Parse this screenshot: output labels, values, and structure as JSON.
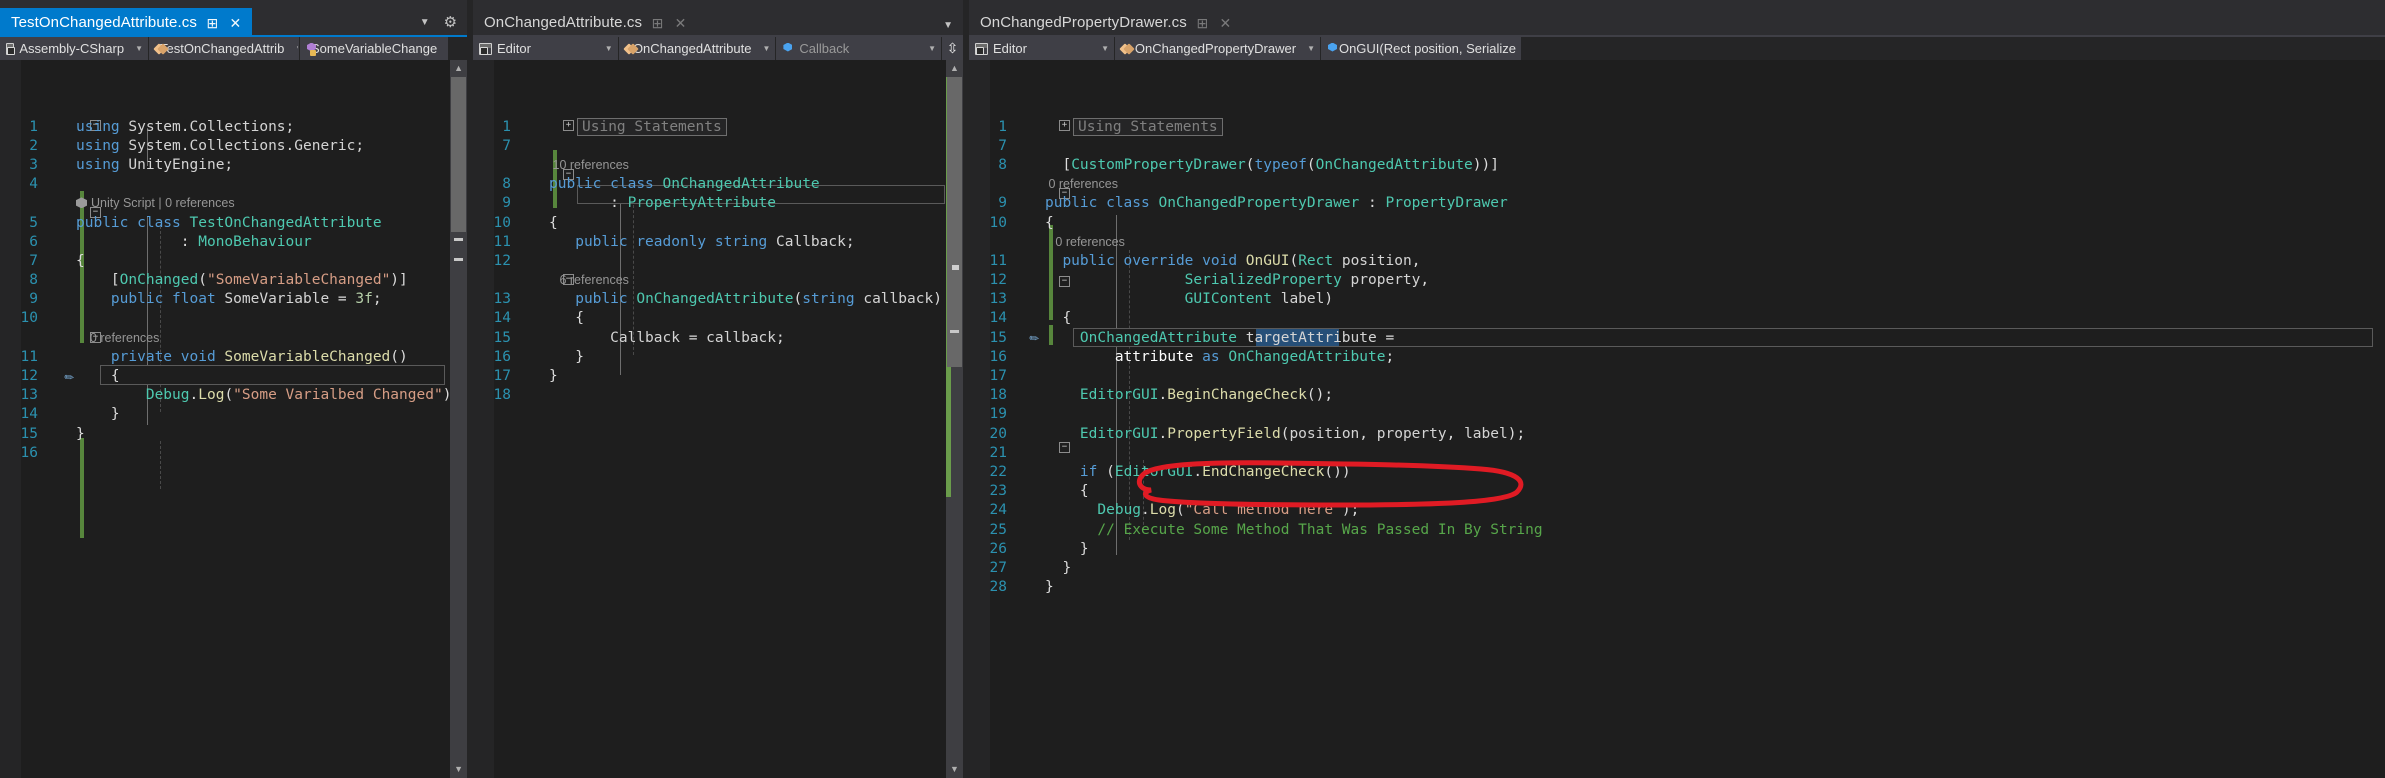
{
  "app": {
    "theme_bg": "#1e1e1e",
    "accent": "#007acc",
    "annotation_color": "#e01b24"
  },
  "panes": [
    {
      "id": "left",
      "tab": {
        "title": "TestOnChangedAttribute.cs",
        "active": true,
        "pin_icon": "pin-icon",
        "close_icon": "close-icon"
      },
      "tabstrip_right": {
        "chevron": "chevron-down-icon",
        "gear": "gear-icon"
      },
      "navbar": [
        {
          "icon": "project-icon",
          "label": "Assembly-CSharp",
          "caret": "caret-down-icon"
        },
        {
          "icon": "class-icon",
          "label": "TestOnChangedAttrib",
          "caret": "caret-down-icon"
        },
        {
          "icon": "field-icon",
          "label": "SomeVariableChange",
          "caret": "caret-down-icon"
        }
      ],
      "splitter_icon": "split-view-icon",
      "lines": [
        {
          "no": "1",
          "text": "using System.Collections;"
        },
        {
          "no": "2",
          "text": "using System.Collections.Generic;"
        },
        {
          "no": "3",
          "text": "using UnityEngine;"
        },
        {
          "no": "4",
          "text": ""
        },
        {
          "no": "5",
          "text": "public class TestOnChangedAttribute"
        },
        {
          "no": "6",
          "text": "            : MonoBehaviour"
        },
        {
          "no": "7",
          "text": "{"
        },
        {
          "no": "8",
          "text": "    [OnChanged(\"SomeVariableChanged\")]"
        },
        {
          "no": "9",
          "text": "    public float SomeVariable = 3f;"
        },
        {
          "no": "10",
          "text": ""
        },
        {
          "no": "11",
          "text": "    private void SomeVariableChanged()"
        },
        {
          "no": "12",
          "text": "    {"
        },
        {
          "no": "13",
          "text": "        Debug.Log(\"Some Varialbed Changed\");"
        },
        {
          "no": "14",
          "text": "    }"
        },
        {
          "no": "15",
          "text": "}"
        },
        {
          "no": "16",
          "text": ""
        }
      ],
      "codelens": [
        {
          "after_line": "4",
          "text": "Unity Script | 0 references",
          "icon": "unity-icon"
        },
        {
          "after_line": "10",
          "text": "0 references",
          "icon": ""
        }
      ],
      "bookmark_line": "13"
    },
    {
      "id": "middle",
      "tab": {
        "title": "OnChangedAttribute.cs",
        "active": false,
        "pin_icon": "pin-icon",
        "close_icon": "close-icon"
      },
      "tabstrip_right": {
        "chevron": "chevron-down-icon",
        "gear": ""
      },
      "navbar": [
        {
          "icon": "project-icon",
          "label": "Editor",
          "caret": "caret-down-icon"
        }
      ],
      "collapsed_region": "Using Statements",
      "lines": [
        {
          "no": "1",
          "text": ""
        },
        {
          "no": "7",
          "text": ""
        },
        {
          "no": "8",
          "text": "public class OnChangedAttribute"
        },
        {
          "no": "9",
          "text": "         : PropertyAttribute"
        },
        {
          "no": "10",
          "text": "{"
        },
        {
          "no": "11",
          "text": "    public readonly string Callback;"
        },
        {
          "no": "12",
          "text": ""
        },
        {
          "no": "13",
          "text": "    public OnChangedAttribute(string callback)"
        },
        {
          "no": "14",
          "text": "    {"
        },
        {
          "no": "15",
          "text": "        Callback = callback;"
        },
        {
          "no": "16",
          "text": "    }"
        },
        {
          "no": "17",
          "text": "}"
        },
        {
          "no": "18",
          "text": ""
        }
      ],
      "codelens": [
        {
          "after_line": "7",
          "text": "10 references"
        },
        {
          "after_line": "12",
          "text": "6 references"
        }
      ]
    },
    {
      "id": "right",
      "tab": {
        "title": "OnChangedPropertyDrawer.cs",
        "active": false,
        "pin_icon": "pin-icon",
        "close_icon": "close-icon"
      },
      "navbar": [
        {
          "icon": "class-icon",
          "label": "OnChangedAttribute",
          "caret": "caret-down-icon"
        },
        {
          "icon": "field-blue-icon",
          "label": "Callback",
          "caret": "caret-down-icon"
        }
      ],
      "splitter_icon": "split-view-icon",
      "navbar_right": [
        {
          "icon": "project-icon",
          "label": "Editor",
          "caret": "caret-down-icon"
        },
        {
          "icon": "class-icon",
          "label": "OnChangedPropertyDrawer",
          "caret": "caret-down-icon"
        },
        {
          "icon": "method-icon",
          "label": "OnGUI(Rect position, Serialize",
          "caret": ""
        }
      ],
      "collapsed_region": "Using Statements",
      "lines": [
        {
          "no": "1",
          "text": ""
        },
        {
          "no": "7",
          "text": ""
        },
        {
          "no": "8",
          "text": "[CustomPropertyDrawer(typeof(OnChangedAttribute))]"
        },
        {
          "no": "9",
          "text": "public class OnChangedPropertyDrawer : PropertyDrawer"
        },
        {
          "no": "10",
          "text": "{"
        },
        {
          "no": "11",
          "text": "    public override void OnGUI(Rect position,"
        },
        {
          "no": "12",
          "text": "                 SerializedProperty property,"
        },
        {
          "no": "13",
          "text": "                 GUIContent label)"
        },
        {
          "no": "14",
          "text": "    {"
        },
        {
          "no": "15",
          "text": "        OnChangedAttribute targetAttribute ="
        },
        {
          "no": "16",
          "text": "            attribute as OnChangedAttribute;"
        },
        {
          "no": "17",
          "text": ""
        },
        {
          "no": "18",
          "text": "        EditorGUI.BeginChangeCheck();"
        },
        {
          "no": "19",
          "text": ""
        },
        {
          "no": "20",
          "text": "        EditorGUI.PropertyField(position, property, label);"
        },
        {
          "no": "21",
          "text": ""
        },
        {
          "no": "22",
          "text": "        if (EditorGUI.EndChangeCheck())"
        },
        {
          "no": "23",
          "text": "        {"
        },
        {
          "no": "24",
          "text": "            Debug.Log(\"Call method here\");"
        },
        {
          "no": "25",
          "text": "            // Execute Some Method That Was Passed In By String"
        },
        {
          "no": "26",
          "text": "        }"
        },
        {
          "no": "27",
          "text": "    }"
        },
        {
          "no": "28",
          "text": "}"
        }
      ],
      "codelens": [
        {
          "after_line": "7",
          "text": "0 references"
        },
        {
          "after_line": "10",
          "text": "0 references"
        }
      ],
      "selection": {
        "line": "16",
        "text": "attribute"
      },
      "bookmark_line": "16",
      "annotation": {
        "shape": "ellipse",
        "target_line": "24",
        "text": "Debug.Log(\"Call method here\");"
      }
    }
  ]
}
